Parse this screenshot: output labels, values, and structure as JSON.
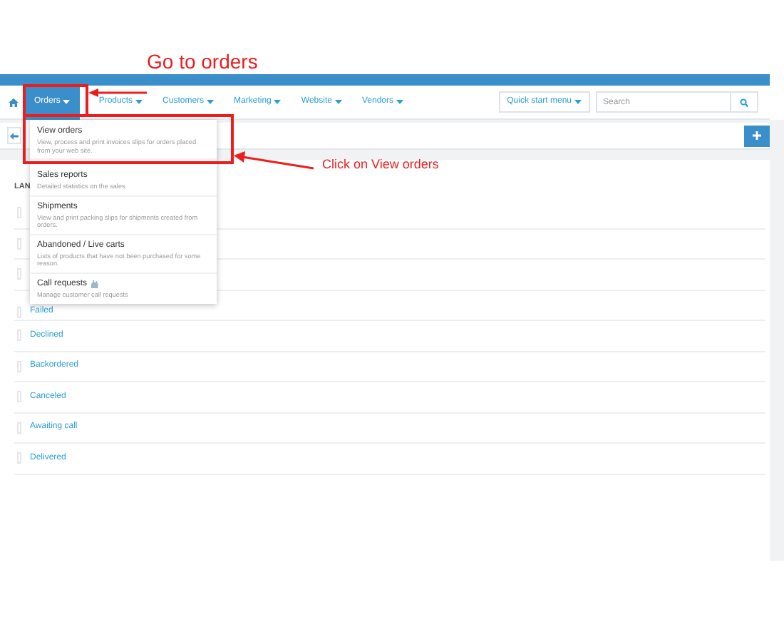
{
  "nav": {
    "items": [
      {
        "label": "Orders",
        "selected": true
      },
      {
        "label": "Products",
        "selected": false
      },
      {
        "label": "Customers",
        "selected": false
      },
      {
        "label": "Marketing",
        "selected": false
      },
      {
        "label": "Website",
        "selected": false
      },
      {
        "label": "Vendors",
        "selected": false
      }
    ],
    "quick_start": "Quick start menu",
    "search": {
      "placeholder": "Search"
    }
  },
  "dropdown": [
    {
      "title": "View orders",
      "description": "View, process and print invoices slips for orders placed from your web site.",
      "kind": "plain"
    },
    {
      "title": "Sales reports",
      "description": "Detailed statistics on the sales.",
      "kind": "plain"
    },
    {
      "title": "Shipments",
      "description": "View and print packing slips for shipments created from orders.",
      "kind": "plain"
    },
    {
      "title": "Abandoned / Live carts",
      "description": "Lists of products that have not been purchased for some reason.",
      "kind": "plain"
    },
    {
      "title": "Call requests",
      "description": "Manage customer call requests",
      "kind": "with-icon"
    }
  ],
  "panel": {
    "label": "LAN",
    "hidden_rows": [
      {
        "checked": false
      },
      {
        "checked": false
      },
      {
        "checked": false
      }
    ],
    "statuses": [
      {
        "name": "Failed",
        "checked": false
      },
      {
        "name": "Declined",
        "checked": false
      },
      {
        "name": "Backordered",
        "checked": false
      },
      {
        "name": "Canceled",
        "checked": false
      },
      {
        "name": "Awaiting call",
        "checked": false
      },
      {
        "name": "Delivered",
        "checked": false
      }
    ]
  },
  "annotations": [
    {
      "text": "Go to orders"
    },
    {
      "text": "Click on View orders"
    }
  ]
}
